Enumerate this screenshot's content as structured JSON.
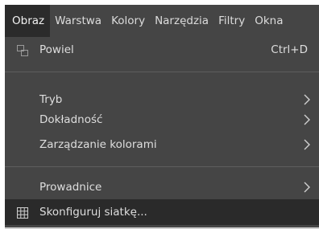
{
  "menubar": {
    "items": [
      {
        "label": "Obraz",
        "active": true
      },
      {
        "label": "Warstwa"
      },
      {
        "label": "Kolory"
      },
      {
        "label": "Narzędzia"
      },
      {
        "label": "Filtry"
      },
      {
        "label": "Okna"
      }
    ]
  },
  "dropdown": {
    "duplicate": {
      "label": "Powiel",
      "shortcut": "Ctrl+D",
      "icon": "duplicate-icon"
    },
    "mode": {
      "label": "Tryb",
      "icon": "submenu-arrow-icon"
    },
    "precision": {
      "label": "Dokładność",
      "icon": "submenu-arrow-icon"
    },
    "color_management": {
      "label": "Zarządzanie kolorami",
      "icon": "submenu-arrow-icon"
    },
    "guides": {
      "label": "Prowadnice",
      "icon": "submenu-arrow-icon"
    },
    "configure_grid": {
      "label": "Skonfiguruj siatkę...",
      "icon": "grid-icon"
    }
  },
  "colors": {
    "menu_bg": "#454545",
    "highlight_bg": "#2a2a2a",
    "text": "#dedede",
    "separator": "#5e5e5e"
  }
}
